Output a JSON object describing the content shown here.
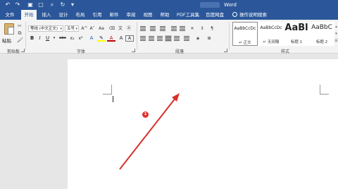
{
  "window": {
    "title": "Word"
  },
  "qat": {
    "icons": [
      "undo-icon",
      "redo-icon",
      "save-icon",
      "new-doc-icon",
      "print-preview-icon",
      "redo-arrow-icon",
      "customize-qat-icon"
    ]
  },
  "tabs": [
    "文件",
    "开始",
    "插入",
    "设计",
    "布局",
    "引用",
    "邮件",
    "审阅",
    "视图",
    "帮助",
    "PDF工具集",
    "百度网盘"
  ],
  "active_tab": "开始",
  "tell_me": "操作说明搜索",
  "clipboard": {
    "paste_label": "粘贴",
    "group_label": "剪贴板"
  },
  "font": {
    "font_name": "等线 (中文正文)",
    "font_size": "五号",
    "grow_label": "A^",
    "shrink_label": "A˅",
    "case_label": "Aa",
    "bold": "B",
    "italic": "I",
    "underline": "U",
    "strike": "abc",
    "subscript": "x₂",
    "superscript": "x²",
    "group_label": "字体"
  },
  "paragraph": {
    "group_label": "段落"
  },
  "styles": {
    "items": [
      {
        "sample": "AaBbCcDc",
        "name": "↵ 正文"
      },
      {
        "sample": "AaBbCcDc",
        "name": "↵ 无间隔"
      },
      {
        "sample": "AaBl",
        "name": "标题 1"
      },
      {
        "sample": "AaBbC",
        "name": "标题 2"
      }
    ],
    "group_label": "样式"
  },
  "annotation": {
    "step": "1"
  },
  "colors": {
    "titlebar": "#2b579a",
    "ribbon": "#f3f3f3",
    "arrow": "#d9302b",
    "badge": "#e2312b"
  }
}
